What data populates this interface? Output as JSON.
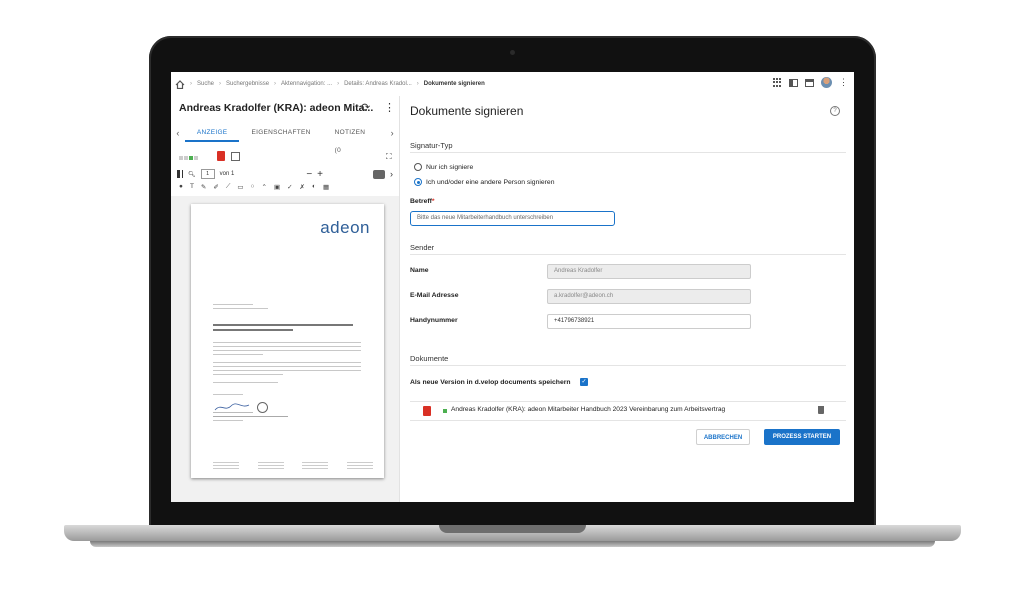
{
  "breadcrumb": {
    "items": [
      "Suche",
      "Suchergebnisse",
      "Aktennavigation: ...",
      "Details: Andreas Kradol...",
      "Dokumente signieren"
    ]
  },
  "left_panel": {
    "title": "Andreas Kradolfer (KRA): adeon Mita...",
    "tabs": [
      "ANZEIGE",
      "EIGENSCHAFTEN",
      "NOTIZEN (0"
    ],
    "active_tab": "ANZEIGE",
    "page_number": "1",
    "page_of": "von 1",
    "document_preview": {
      "logo": "adeon"
    }
  },
  "right_panel": {
    "title": "Dokumente signieren",
    "signature_type": {
      "heading": "Signatur-Typ",
      "options": [
        "Nur ich signiere",
        "Ich und/oder eine andere Person signieren"
      ],
      "selected": "Ich und/oder eine andere Person signieren"
    },
    "subject": {
      "label": "Betreff",
      "required_mark": "*",
      "value": "Bitte das neue Mitarbeiterhandbuch unterschreiben"
    },
    "sender": {
      "heading": "Sender",
      "name_label": "Name",
      "name_value": "Andreas Kradolfer",
      "email_label": "E-Mail Adresse",
      "email_value": "a.kradolfer@adeon.ch",
      "phone_label": "Handynummer",
      "phone_value": "+41796738921"
    },
    "documents": {
      "heading": "Dokumente",
      "save_version_label": "Als neue Version in d.velop documents speichern",
      "save_version_checked": true,
      "items": [
        "Andreas Kradolfer (KRA): adeon Mitarbeiter Handbuch 2023 Vereinbarung zum Arbeitsvertrag"
      ]
    },
    "buttons": {
      "cancel": "ABBRECHEN",
      "start": "PROZESS STARTEN"
    }
  },
  "colors": {
    "accent": "#1a73c9",
    "pdf": "#d93025",
    "status_green": "#4caf50"
  }
}
